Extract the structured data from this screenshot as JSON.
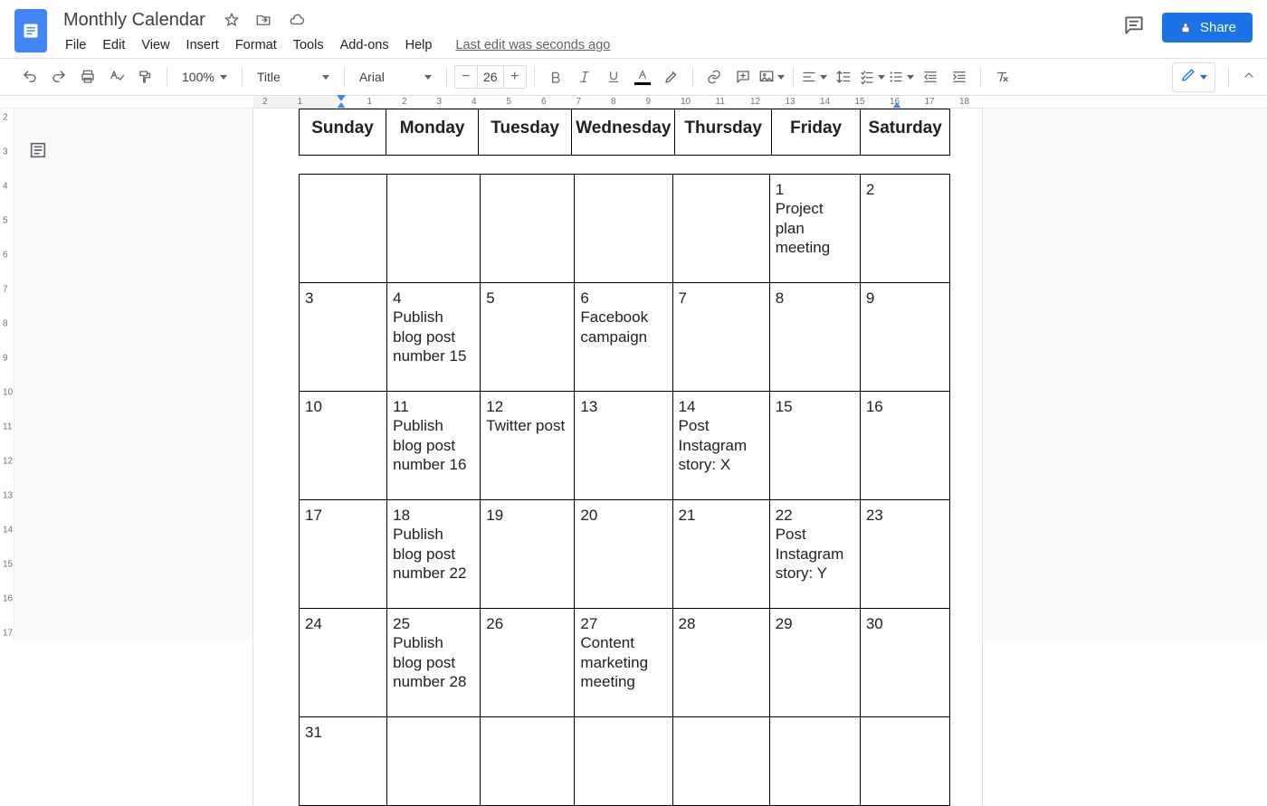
{
  "doc": {
    "title": "Monthly Calendar"
  },
  "menus": {
    "file": "File",
    "edit": "Edit",
    "view": "View",
    "insert": "Insert",
    "format": "Format",
    "tools": "Tools",
    "addons": "Add-ons",
    "help": "Help",
    "last_edit": "Last edit was seconds ago"
  },
  "share": {
    "label": "Share"
  },
  "toolbar": {
    "zoom": "100%",
    "style": "Title",
    "font": "Arial",
    "font_size": "26",
    "minus": "−",
    "plus": "+"
  },
  "ruler_h": [
    "2",
    "1",
    "",
    "1",
    "2",
    "3",
    "4",
    "5",
    "6",
    "7",
    "8",
    "9",
    "10",
    "11",
    "12",
    "13",
    "14",
    "15",
    "16",
    "17",
    "18"
  ],
  "ruler_v": [
    "2",
    "3",
    "4",
    "5",
    "6",
    "7",
    "8",
    "9",
    "10",
    "11",
    "12",
    "13",
    "14",
    "15",
    "16",
    "17"
  ],
  "calendar": {
    "days": [
      "Sunday",
      "Monday",
      "Tuesday",
      "Wednesday",
      "Thursday",
      "Friday",
      "Saturday"
    ],
    "weeks": [
      [
        {
          "n": "",
          "e": ""
        },
        {
          "n": "",
          "e": ""
        },
        {
          "n": "",
          "e": ""
        },
        {
          "n": "",
          "e": ""
        },
        {
          "n": "",
          "e": ""
        },
        {
          "n": "1",
          "e": "Project plan meeting"
        },
        {
          "n": "2",
          "e": ""
        }
      ],
      [
        {
          "n": "3",
          "e": ""
        },
        {
          "n": "4",
          "e": "Publish blog post number 15"
        },
        {
          "n": "5",
          "e": ""
        },
        {
          "n": "6",
          "e": "Facebook campaign"
        },
        {
          "n": "7",
          "e": ""
        },
        {
          "n": "8",
          "e": ""
        },
        {
          "n": "9",
          "e": ""
        }
      ],
      [
        {
          "n": "10",
          "e": ""
        },
        {
          "n": "11",
          "e": "Publish blog post number 16"
        },
        {
          "n": "12",
          "e": "Twitter post"
        },
        {
          "n": "13",
          "e": ""
        },
        {
          "n": "14",
          "e": "Post Instagram story: X"
        },
        {
          "n": "15",
          "e": ""
        },
        {
          "n": "16",
          "e": ""
        }
      ],
      [
        {
          "n": "17",
          "e": ""
        },
        {
          "n": "18",
          "e": "Publish blog post number 22"
        },
        {
          "n": "19",
          "e": ""
        },
        {
          "n": "20",
          "e": ""
        },
        {
          "n": "21",
          "e": ""
        },
        {
          "n": "22",
          "e": "Post Instagram story: Y"
        },
        {
          "n": "23",
          "e": ""
        }
      ],
      [
        {
          "n": "24",
          "e": ""
        },
        {
          "n": "25",
          "e": "Publish blog post number 28"
        },
        {
          "n": "26",
          "e": ""
        },
        {
          "n": "27",
          "e": "Content marketing meeting"
        },
        {
          "n": "28",
          "e": ""
        },
        {
          "n": "29",
          "e": ""
        },
        {
          "n": "30",
          "e": ""
        }
      ],
      [
        {
          "n": "31",
          "e": ""
        },
        {
          "n": "",
          "e": ""
        },
        {
          "n": "",
          "e": ""
        },
        {
          "n": "",
          "e": ""
        },
        {
          "n": "",
          "e": ""
        },
        {
          "n": "",
          "e": ""
        },
        {
          "n": "",
          "e": ""
        }
      ]
    ]
  }
}
